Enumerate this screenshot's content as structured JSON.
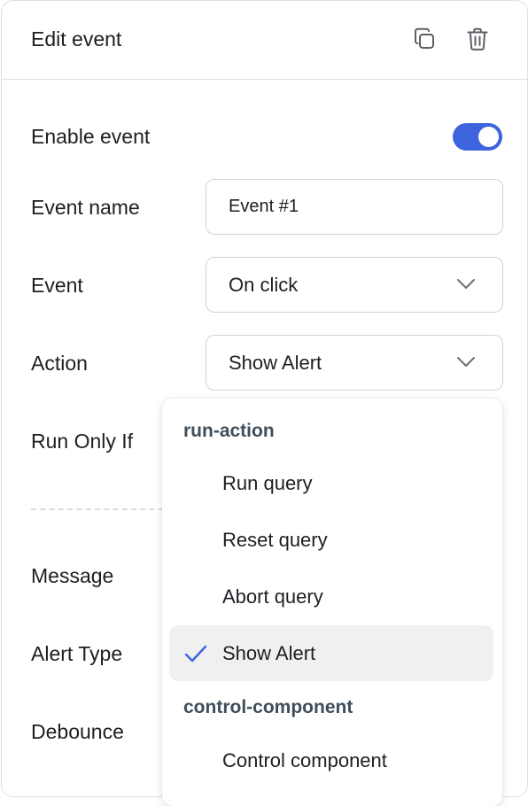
{
  "header": {
    "title": "Edit event",
    "icons": [
      "copy-icon",
      "trash-icon"
    ]
  },
  "form": {
    "enable_event_label": "Enable event",
    "enable_event_on": true,
    "event_name_label": "Event name",
    "event_name_value": "Event #1",
    "event_label": "Event",
    "event_value": "On click",
    "action_label": "Action",
    "action_value": "Show Alert",
    "run_only_if_label": "Run Only If",
    "message_label": "Message",
    "alert_type_label": "Alert Type",
    "debounce_label": "Debounce"
  },
  "dropdown": {
    "groups": [
      {
        "label": "run-action",
        "options": [
          "Run query",
          "Reset query",
          "Abort query",
          "Show Alert"
        ]
      },
      {
        "label": "control-component",
        "options": [
          "Control component"
        ]
      }
    ],
    "selected": "Show Alert"
  },
  "colors": {
    "accent": "#3d63dd",
    "selected_bg": "#f0f0f1",
    "group_label": "#3f4f5a"
  }
}
